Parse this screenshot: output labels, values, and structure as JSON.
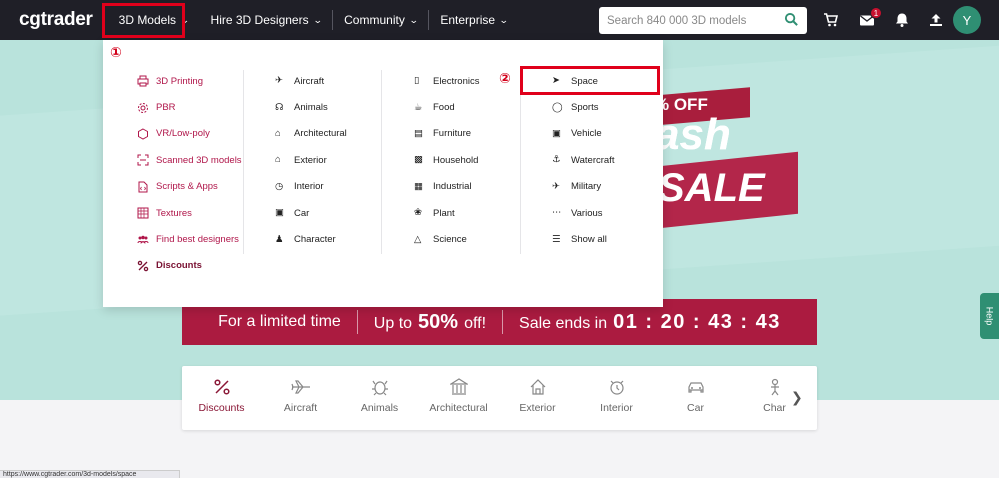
{
  "nav": {
    "logo": "cgtrader",
    "items": [
      "3D Models",
      "Hire 3D Designers",
      "Community",
      "Enterprise"
    ],
    "search_placeholder": "Search 840 000 3D models",
    "mail_badge": "1",
    "avatar_initial": "Y"
  },
  "hero": {
    "sale_pct_text": "% OFF",
    "flash_text": "ash",
    "sale_text": "SALE",
    "promo": {
      "limited": "For a limited time",
      "upto": "Up to",
      "percent": "50%",
      "off": "off!",
      "ends": "Sale ends in",
      "timer": "01 : 20 : 43 : 43"
    },
    "help_label": "Help"
  },
  "dropdown": {
    "col1": [
      "3D Printing",
      "PBR",
      "VR/Low-poly",
      "Scanned 3D models",
      "Scripts & Apps",
      "Textures",
      "Find best designers",
      "Discounts"
    ],
    "col2": [
      "Aircraft",
      "Animals",
      "Architectural",
      "Exterior",
      "Interior",
      "Car",
      "Character"
    ],
    "col3": [
      "Electronics",
      "Food",
      "Furniture",
      "Household",
      "Industrial",
      "Plant",
      "Science"
    ],
    "col4": [
      "Space",
      "Sports",
      "Vehicle",
      "Watercraft",
      "Military",
      "Various",
      "Show all"
    ]
  },
  "categories": [
    "Discounts",
    "Aircraft",
    "Animals",
    "Architectural",
    "Exterior",
    "Interior",
    "Car",
    "Char"
  ],
  "annotations": [
    "①",
    "②"
  ],
  "status_url": "https://www.cgtrader.com/3d-models/space",
  "colors": {
    "nav_bg": "#1f1f27",
    "accent": "#ab1b40",
    "hero_bg": "#b9e3dc",
    "annotation": "#e0001b",
    "avatar": "#2f8f73"
  }
}
